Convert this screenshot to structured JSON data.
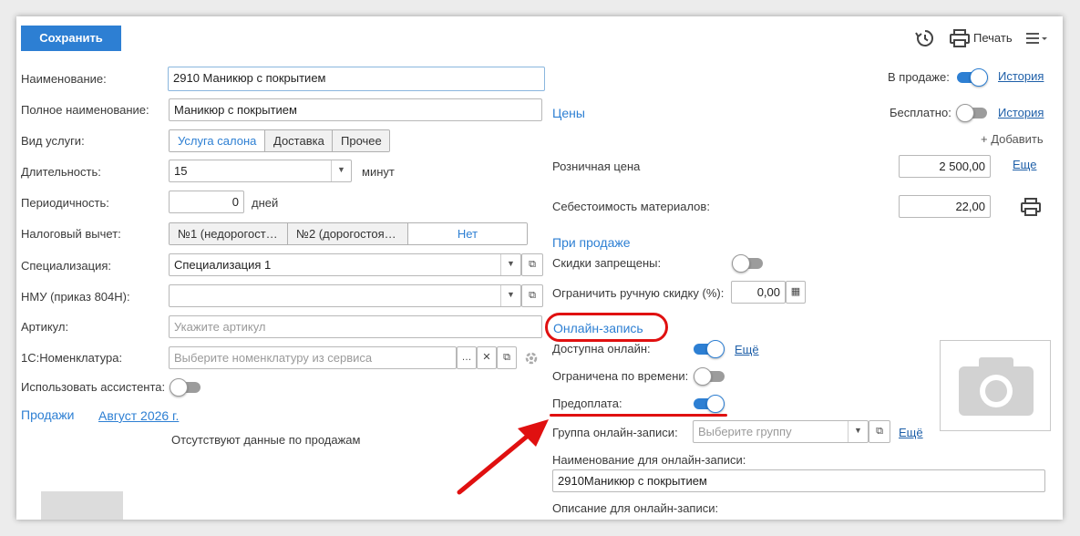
{
  "toolbar": {
    "save_label": "Сохранить",
    "history_icon": "history-icon",
    "print_label": "Печать",
    "more_icon": "menu-icon"
  },
  "left": {
    "name_label": "Наименование:",
    "name_value": "2910 Маникюр с покрытием",
    "full_name_label": "Полное наименование:",
    "full_name_value": "Маникюр с покрытием",
    "service_type_label": "Вид услуги:",
    "service_types": [
      "Услуга салона",
      "Доставка",
      "Прочее"
    ],
    "service_type_selected": "Услуга салона",
    "duration_label": "Длительность:",
    "duration_value": "15",
    "duration_unit": "минут",
    "periodicity_label": "Периодичность:",
    "periodicity_value": "0",
    "periodicity_unit": "дней",
    "tax_label": "Налоговый вычет:",
    "tax_options": [
      "№1 (недорогост…",
      "№2 (дорогостоя…",
      "Нет"
    ],
    "tax_selected": "Нет",
    "specialization_label": "Специализация:",
    "specialization_value": "Специализация 1",
    "nmu_label": "НМУ (приказ 804Н):",
    "nmu_value": "",
    "article_label": "Артикул:",
    "article_placeholder": "Укажите артикул",
    "nomenclature_label": "1С:Номенклатура:",
    "nomenclature_placeholder": "Выберите номенклатуру из сервиса",
    "assistant_label": "Использовать ассистента:",
    "assistant_on": false,
    "sales_title": "Продажи",
    "sales_period": "Август 2026 г.",
    "sales_empty": "Отсутствуют данные по продажам"
  },
  "right": {
    "on_sale_label": "В продаже:",
    "on_sale": true,
    "history_link": "История",
    "prices_title": "Цены",
    "free_label": "Бесплатно:",
    "free": false,
    "add_label": "+ Добавить",
    "retail_label": "Розничная цена",
    "retail_value": "2 500,00",
    "more_link": "Еще",
    "cost_label": "Себестоимость материалов:",
    "cost_value": "22,00",
    "on_sale_title": "При продаже",
    "discounts_label": "Скидки запрещены:",
    "discounts_forbidden": false,
    "limit_label": "Ограничить ручную скидку (%):",
    "limit_value": "0,00",
    "online_title": "Онлайн-запись",
    "online_available_label": "Доступна онлайн:",
    "online_available": true,
    "more_link2": "Ещё",
    "time_limited_label": "Ограничена по времени:",
    "time_limited": false,
    "prepay_label": "Предоплата:",
    "prepay": true,
    "group_label": "Группа онлайн-записи:",
    "group_placeholder": "Выберите группу",
    "online_name_label": "Наименование для онлайн-записи:",
    "online_name_value": "2910Маникюр с покрытием",
    "online_desc_label": "Описание для онлайн-записи:"
  },
  "colors": {
    "accent": "#2d7fd3",
    "annotation": "#e01010"
  }
}
